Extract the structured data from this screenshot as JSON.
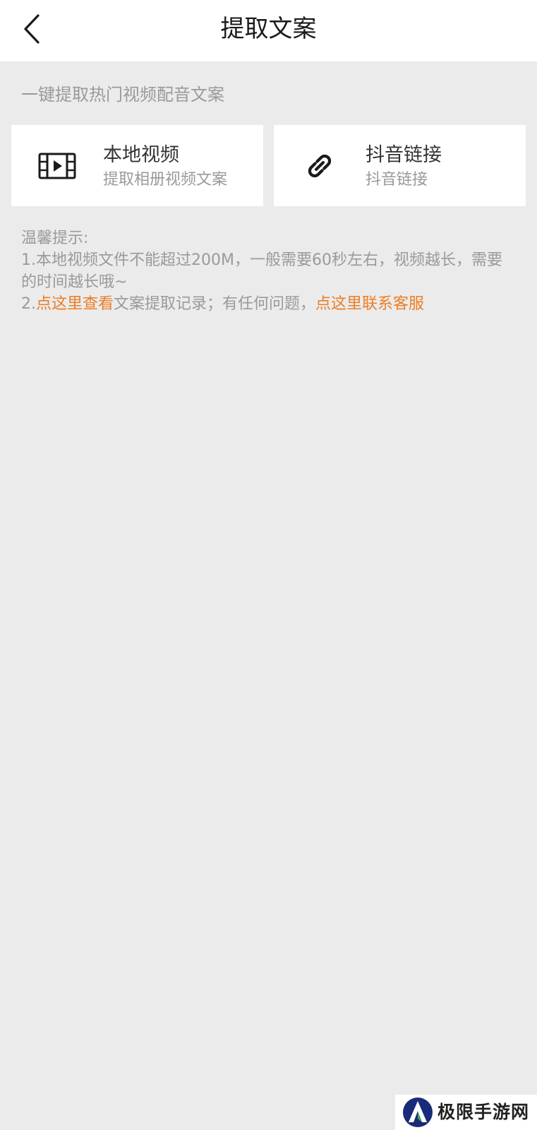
{
  "header": {
    "title": "提取文案",
    "back_icon": "chevron-left-icon"
  },
  "subtitle": "一键提取热门视频配音文案",
  "cards": {
    "local_video": {
      "icon": "film-icon",
      "title": "本地视频",
      "subtitle": "提取相册视频文案"
    },
    "douyin_link": {
      "icon": "link-icon",
      "title": "抖音链接",
      "subtitle": "抖音链接"
    }
  },
  "tips": {
    "heading": "温馨提示:",
    "line1": "1.本地视频文件不能超过200M，一般需要60秒左右，视频越长，需要的时间越长哦~",
    "line2_prefix": "2.",
    "line2_link1": "点这里查看",
    "line2_middle": "文案提取记录；有任何问题，",
    "line2_link2": "点这里联系客服"
  },
  "watermark": {
    "text": "极限手游网"
  },
  "colors": {
    "background": "#ebebeb",
    "card": "#ffffff",
    "accent_orange": "#ee7d23",
    "muted_text": "#9a9a9a"
  }
}
